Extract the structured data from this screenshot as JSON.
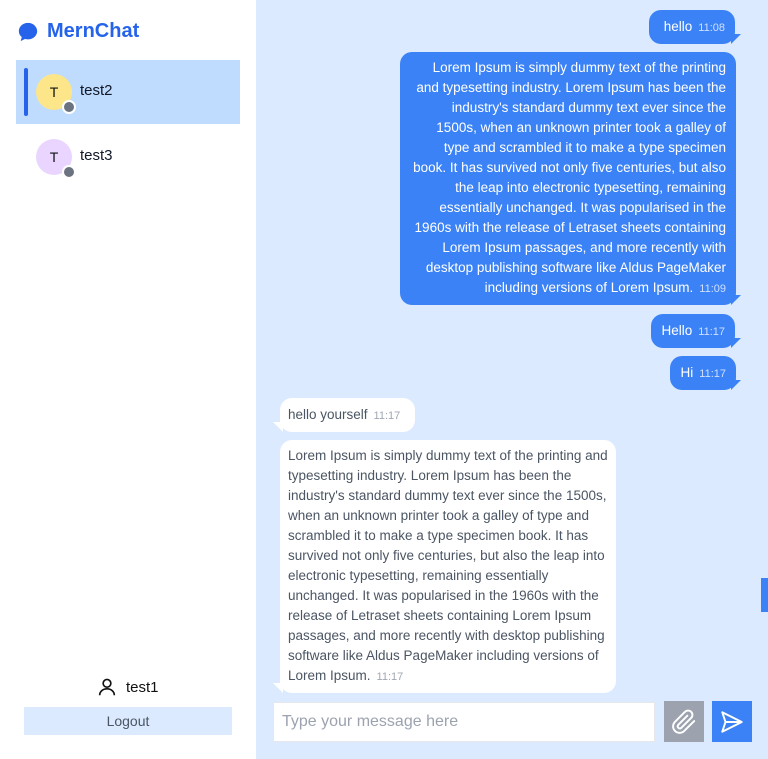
{
  "app": {
    "title": "MernChat"
  },
  "contacts": [
    {
      "initial": "T",
      "name": "test2",
      "avatar_bg": "#fde68a",
      "active": true
    },
    {
      "initial": "T",
      "name": "test3",
      "avatar_bg": "#e9d5ff",
      "active": false
    }
  ],
  "current_user": {
    "name": "test1"
  },
  "logout_label": "Logout",
  "messages": [
    {
      "direction": "out",
      "text": "hello",
      "time": "11:08"
    },
    {
      "direction": "out",
      "text": "Lorem Ipsum is simply dummy text of the printing and typesetting industry. Lorem Ipsum has been the industry's standard dummy text ever since the 1500s, when an unknown printer took a galley of type and scrambled it to make a type specimen book. It has survived not only five centuries, but also the leap into electronic typesetting, remaining essentially unchanged. It was popularised in the 1960s with the release of Letraset sheets containing Lorem Ipsum passages, and more recently with desktop publishing software like Aldus PageMaker including versions of Lorem Ipsum.",
      "time": "11:09"
    },
    {
      "direction": "out",
      "text": "Hello",
      "time": "11:17"
    },
    {
      "direction": "out",
      "text": "Hi",
      "time": "11:17"
    },
    {
      "direction": "in",
      "text": "hello yourself",
      "time": "11:17"
    },
    {
      "direction": "in",
      "text": "Lorem Ipsum is simply dummy text of the printing and typesetting industry. Lorem Ipsum has been the industry's standard dummy text ever since the 1500s, when an unknown printer took a galley of type and scrambled it to make a type specimen book. It has survived not only five centuries, but also the leap into electronic typesetting, remaining essentially unchanged. It was popularised in the 1960s with the release of Letraset sheets containing Lorem Ipsum passages, and more recently with desktop publishing software like Aldus PageMaker including versions of Lorem Ipsum.",
      "time": "11:17"
    }
  ],
  "composer": {
    "placeholder": "Type your message here"
  },
  "icons": {
    "logo": "chat-bubble-icon",
    "user": "user-icon",
    "attach": "paperclip-icon",
    "send": "send-icon"
  },
  "colors": {
    "accent": "#3b82f6",
    "brand": "#2563eb",
    "chat_bg": "#dbeafe",
    "active_contact": "#bfdbfe"
  }
}
